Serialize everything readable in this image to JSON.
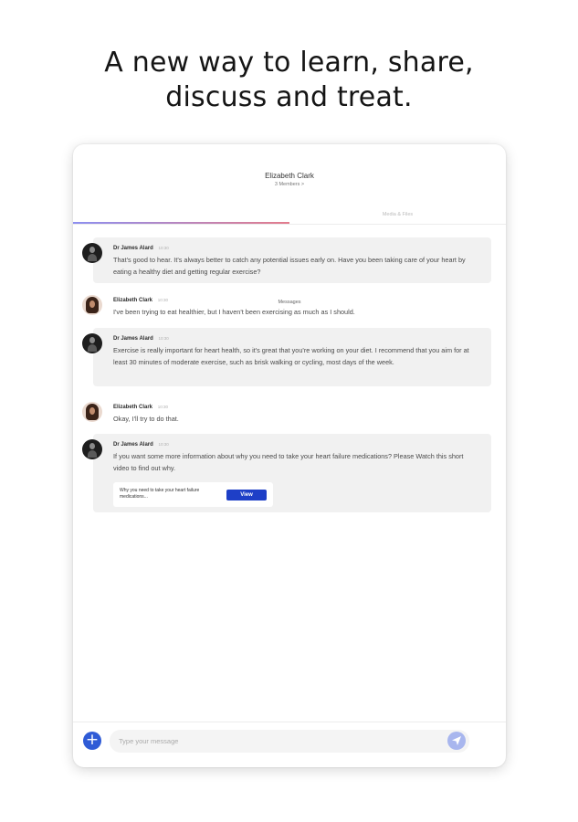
{
  "headline": {
    "line1": "A new way to learn, share,",
    "line2": "discuss and treat."
  },
  "chat": {
    "title": "Elizabeth Clark",
    "subtitle": "3 Members >",
    "tabs": [
      {
        "label": "Messages",
        "active": true
      },
      {
        "label": "Media & Files",
        "active": false
      }
    ]
  },
  "messages": [
    {
      "sender": "Dr James Alard",
      "time": "10:30",
      "avatar": "doctor-avatar",
      "text": "That's good to hear. It's always better to catch any potential issues early on. Have you been taking care of your heart by eating a healthy diet and getting regular exercise?"
    },
    {
      "sender": "Elizabeth Clark",
      "time": "10:30",
      "avatar": "patient-avatar",
      "text": "I've been trying to eat healthier, but I haven't been exercising as much as I should."
    },
    {
      "sender": "Dr James Alard",
      "time": "10:30",
      "avatar": "doctor-avatar",
      "text": "Exercise is really important for heart health, so it's great that you're working on your diet. I recommend that you aim for at least 30 minutes of moderate exercise, such as brisk walking or cycling, most days of the week."
    },
    {
      "sender": "Elizabeth Clark",
      "time": "10:30",
      "avatar": "patient-avatar",
      "text": "Okay, I'll try to do that."
    },
    {
      "sender": "Dr James Alard",
      "time": "10:30",
      "avatar": "doctor-avatar",
      "text": "If you want some more information about why you need to take your heart failure medications? Please Watch this short video to find out why.",
      "attachment": {
        "text": "Why you need to take your heart failure medications...",
        "button_label": "View"
      }
    }
  ],
  "composer": {
    "placeholder": "Type your message",
    "add_icon": "plus-icon",
    "send_icon": "send-icon"
  },
  "colors": {
    "accent": "#1e3fc7",
    "add_button": "#2f5bd6",
    "send_button": "#a8b6ee",
    "bubble_grey": "#f1f1f1"
  }
}
